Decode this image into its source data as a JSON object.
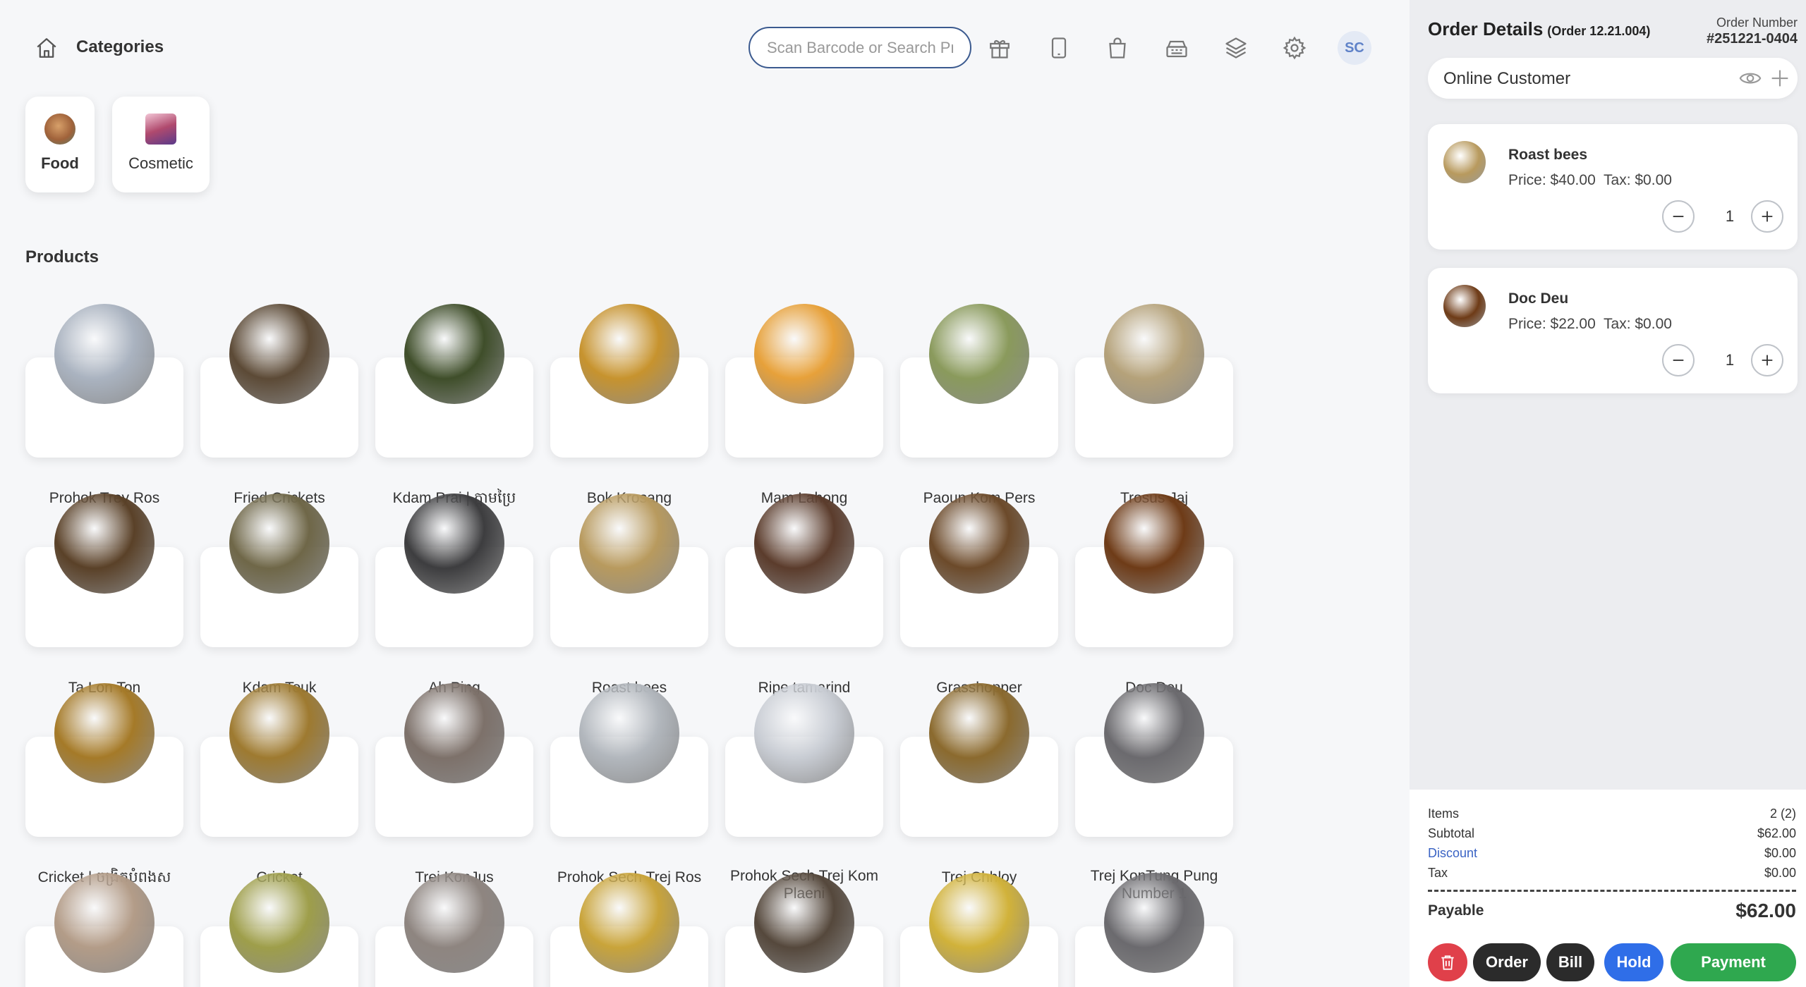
{
  "header": {
    "categories_title": "Categories",
    "search_placeholder": "Scan Barcode or Search Product",
    "avatar_initials": "SC"
  },
  "categories": [
    {
      "label": "Food",
      "selected": true,
      "color": "#a0623a"
    },
    {
      "label": "Cosmetic",
      "selected": false,
      "color": "#b04a6e"
    }
  ],
  "products_title": "Products",
  "products": [
    {
      "name": "Prohok Trey Ros",
      "color": "#aab3c0"
    },
    {
      "name": "Fried Crickets",
      "color": "#5c4a36"
    },
    {
      "name": "Kdam Prai | ក្តាមប្រៃ",
      "color": "#3f4e2a"
    },
    {
      "name": "Bok Krosang",
      "color": "#c7932e"
    },
    {
      "name": "Mam Lahong",
      "color": "#e7a13a"
    },
    {
      "name": "Paoun Kom Pers",
      "color": "#8a9a5c"
    },
    {
      "name": "Trosus Jaj",
      "color": "#b5a27a"
    },
    {
      "name": "Ta Lon Ton",
      "color": "#5a4128"
    },
    {
      "name": "Kdam Touk",
      "color": "#6f6748"
    },
    {
      "name": "Ah Ping",
      "color": "#3d3d3f"
    },
    {
      "name": "Roast bees",
      "color": "#b89a5e"
    },
    {
      "name": "Ripe tamarind",
      "color": "#5b3c2c"
    },
    {
      "name": "Grasshopper",
      "color": "#6c4a2a"
    },
    {
      "name": "Doc Deu",
      "color": "#6e3b17"
    },
    {
      "name": "Cricket | ចង្រិតបំពងស",
      "color": "#a57a28"
    },
    {
      "name": "Cricket",
      "color": "#9e7a30"
    },
    {
      "name": "Trei KonJus",
      "color": "#7d716a"
    },
    {
      "name": "Prohok Sech Trej Ros",
      "color": "#b2b7bd"
    },
    {
      "name": "Prohok Sech Trej Kom Plaeni",
      "color": "#c9cdd4"
    },
    {
      "name": "Trej Chhloy",
      "color": "#8b6a2e"
    },
    {
      "name": "Trej KonTung Pung Number 1",
      "color": "#6b6a6e"
    },
    {
      "name": "",
      "color": "#b39c88"
    },
    {
      "name": "",
      "color": "#9e9e4a"
    },
    {
      "name": "",
      "color": "#8e8580"
    },
    {
      "name": "",
      "color": "#c9a43a"
    },
    {
      "name": "",
      "color": "#55483c"
    },
    {
      "name": "",
      "color": "#d1b23a"
    },
    {
      "name": "",
      "color": "#6b6a6e"
    }
  ],
  "order": {
    "title": "Order Details",
    "order_ref": "(Order 12.21.004)",
    "number_label": "Order Number",
    "number_value": "#251221-0404",
    "customer": "Online Customer",
    "items": [
      {
        "name": "Roast bees",
        "price_text": "Price: $40.00  Tax: $0.00",
        "qty": "1",
        "color": "#b89a5e"
      },
      {
        "name": "Doc Deu",
        "price_text": "Price: $22.00  Tax: $0.00",
        "qty": "1",
        "color": "#6e3b17"
      }
    ]
  },
  "summary": {
    "items_label": "Items",
    "items_value": "2 (2)",
    "subtotal_label": "Subtotal",
    "subtotal_value": "$62.00",
    "discount_label": "Discount",
    "discount_value": "$0.00",
    "tax_label": "Tax",
    "tax_value": "$0.00",
    "payable_label": "Payable",
    "payable_value": "$62.00"
  },
  "actions": {
    "order": "Order",
    "bill": "Bill",
    "hold": "Hold",
    "payment": "Payment"
  }
}
